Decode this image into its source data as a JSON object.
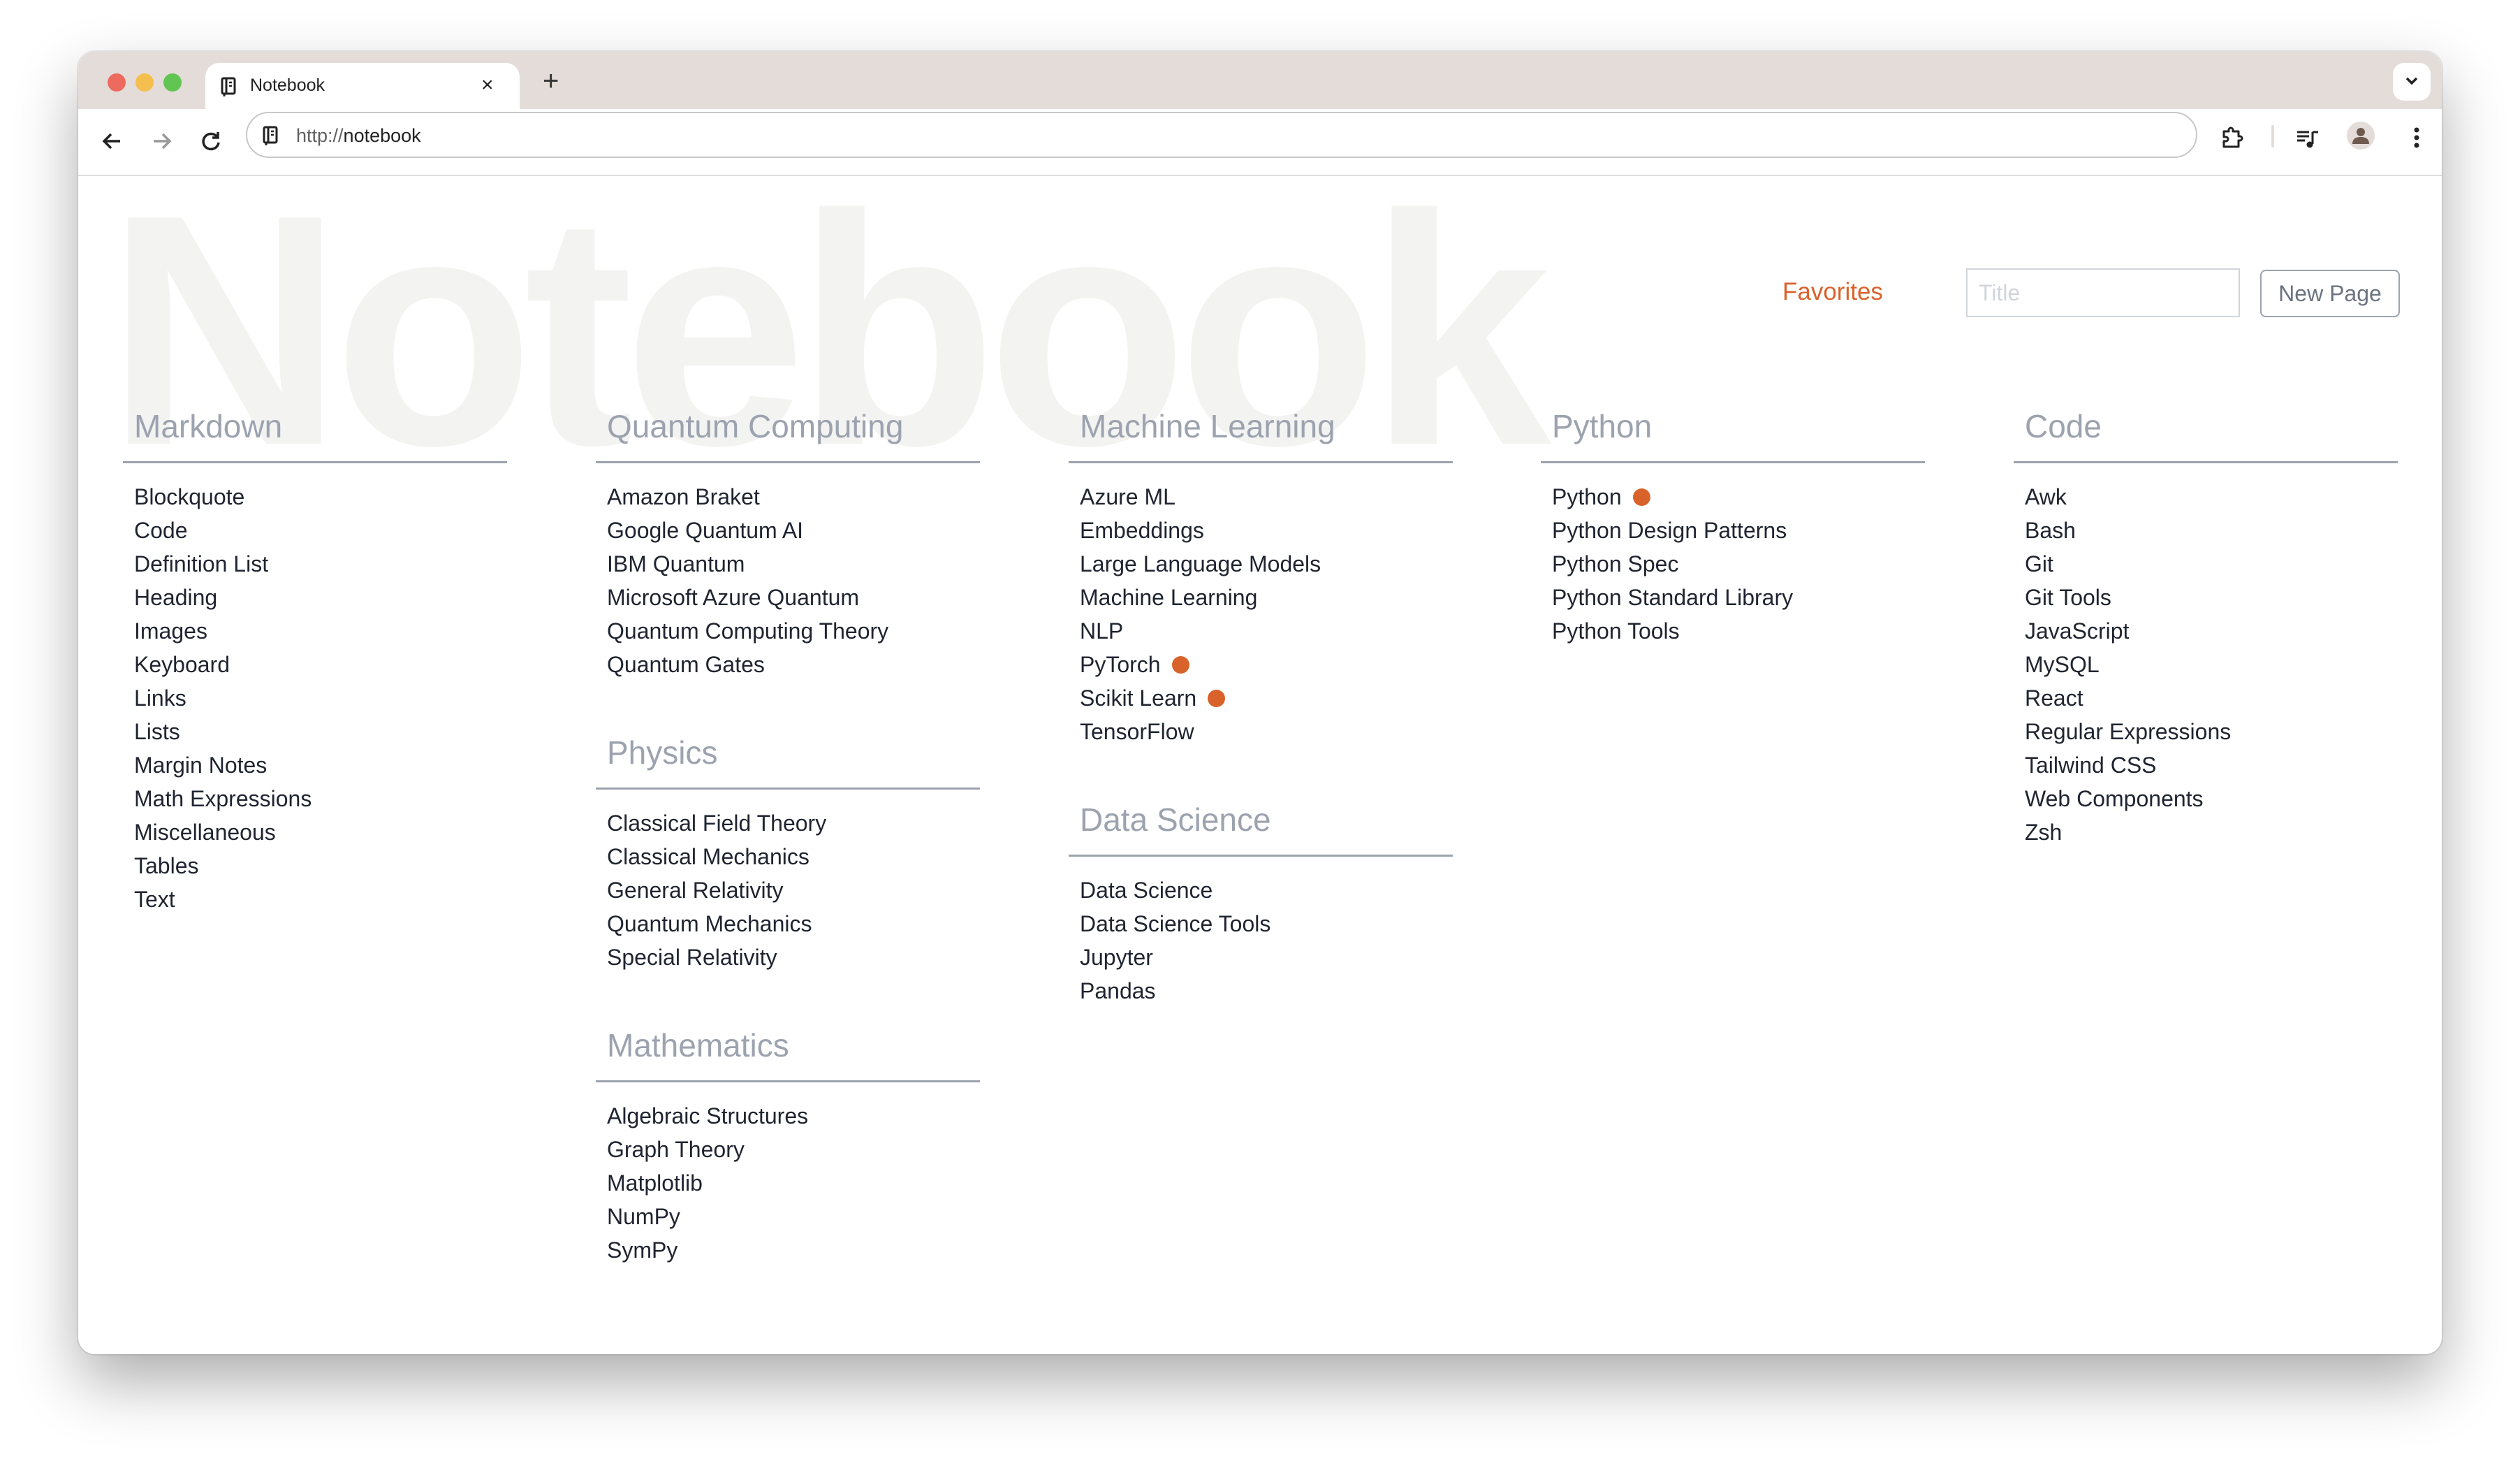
{
  "browser": {
    "tab_title": "Notebook",
    "tab_close": "×",
    "new_tab": "+",
    "url_protocol": "http://",
    "url_host": "notebook"
  },
  "header": {
    "watermark": "Notebook",
    "favorites_label": "Favorites",
    "title_placeholder": "Title",
    "title_value": "",
    "new_page_label": "New Page"
  },
  "colors": {
    "accent": "#d9622b",
    "heading": "#9ca3af",
    "text": "#1f2430",
    "tabstrip": "#e4dcd9"
  },
  "columns": [
    {
      "sections": [
        {
          "title": "Markdown",
          "items": [
            {
              "label": "Blockquote",
              "favorite": false
            },
            {
              "label": "Code",
              "favorite": false
            },
            {
              "label": "Definition List",
              "favorite": false
            },
            {
              "label": "Heading",
              "favorite": false
            },
            {
              "label": "Images",
              "favorite": false
            },
            {
              "label": "Keyboard",
              "favorite": false
            },
            {
              "label": "Links",
              "favorite": false
            },
            {
              "label": "Lists",
              "favorite": false
            },
            {
              "label": "Margin Notes",
              "favorite": false
            },
            {
              "label": "Math Expressions",
              "favorite": false
            },
            {
              "label": "Miscellaneous",
              "favorite": false
            },
            {
              "label": "Tables",
              "favorite": false
            },
            {
              "label": "Text",
              "favorite": false
            }
          ]
        }
      ]
    },
    {
      "sections": [
        {
          "title": "Quantum Computing",
          "items": [
            {
              "label": "Amazon Braket",
              "favorite": false
            },
            {
              "label": "Google Quantum AI",
              "favorite": false
            },
            {
              "label": "IBM Quantum",
              "favorite": false
            },
            {
              "label": "Microsoft Azure Quantum",
              "favorite": false
            },
            {
              "label": "Quantum Computing Theory",
              "favorite": false
            },
            {
              "label": "Quantum Gates",
              "favorite": false
            }
          ]
        },
        {
          "title": "Physics",
          "items": [
            {
              "label": "Classical Field Theory",
              "favorite": false
            },
            {
              "label": "Classical Mechanics",
              "favorite": false
            },
            {
              "label": "General Relativity",
              "favorite": false
            },
            {
              "label": "Quantum Mechanics",
              "favorite": false
            },
            {
              "label": "Special Relativity",
              "favorite": false
            }
          ]
        },
        {
          "title": "Mathematics",
          "items": [
            {
              "label": "Algebraic Structures",
              "favorite": false
            },
            {
              "label": "Graph Theory",
              "favorite": false
            },
            {
              "label": "Matplotlib",
              "favorite": false
            },
            {
              "label": "NumPy",
              "favorite": false
            },
            {
              "label": "SymPy",
              "favorite": false
            }
          ]
        }
      ]
    },
    {
      "sections": [
        {
          "title": "Machine Learning",
          "items": [
            {
              "label": "Azure ML",
              "favorite": false
            },
            {
              "label": "Embeddings",
              "favorite": false
            },
            {
              "label": "Large Language Models",
              "favorite": false
            },
            {
              "label": "Machine Learning",
              "favorite": false
            },
            {
              "label": "NLP",
              "favorite": false
            },
            {
              "label": "PyTorch",
              "favorite": true
            },
            {
              "label": "Scikit Learn",
              "favorite": true
            },
            {
              "label": "TensorFlow",
              "favorite": false
            }
          ]
        },
        {
          "title": "Data Science",
          "items": [
            {
              "label": "Data Science",
              "favorite": false
            },
            {
              "label": "Data Science Tools",
              "favorite": false
            },
            {
              "label": "Jupyter",
              "favorite": false
            },
            {
              "label": "Pandas",
              "favorite": false
            }
          ]
        }
      ]
    },
    {
      "sections": [
        {
          "title": "Python",
          "items": [
            {
              "label": "Python",
              "favorite": true
            },
            {
              "label": "Python Design Patterns",
              "favorite": false
            },
            {
              "label": "Python Spec",
              "favorite": false
            },
            {
              "label": "Python Standard Library",
              "favorite": false
            },
            {
              "label": "Python Tools",
              "favorite": false
            }
          ]
        }
      ]
    },
    {
      "sections": [
        {
          "title": "Code",
          "items": [
            {
              "label": "Awk",
              "favorite": false
            },
            {
              "label": "Bash",
              "favorite": false
            },
            {
              "label": "Git",
              "favorite": false
            },
            {
              "label": "Git Tools",
              "favorite": false
            },
            {
              "label": "JavaScript",
              "favorite": false
            },
            {
              "label": "MySQL",
              "favorite": false
            },
            {
              "label": "React",
              "favorite": false
            },
            {
              "label": "Regular Expressions",
              "favorite": false
            },
            {
              "label": "Tailwind CSS",
              "favorite": false
            },
            {
              "label": "Web Components",
              "favorite": false
            },
            {
              "label": "Zsh",
              "favorite": false
            }
          ]
        }
      ]
    }
  ]
}
